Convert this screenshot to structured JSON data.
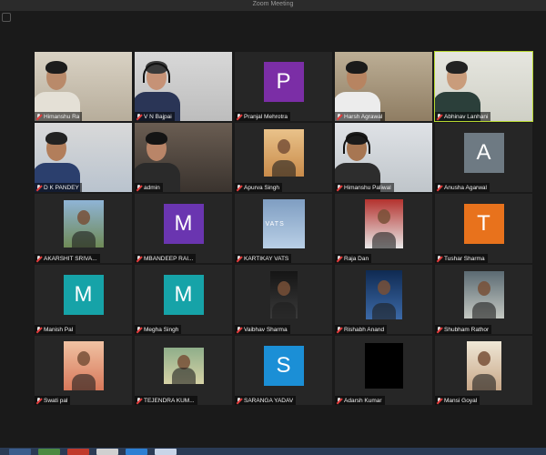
{
  "window": {
    "title": "Zoom Meeting"
  },
  "colors": {
    "tile_bg": "#262626",
    "active_border": "#b6d630",
    "muted_mic": "#e23b3b"
  },
  "participants": [
    {
      "name": "Himanshu Ra",
      "type": "video"
    },
    {
      "name": "V N Bajpai",
      "type": "video"
    },
    {
      "name": "Pranjal Mehrotra",
      "type": "initial",
      "initial": "P",
      "color": "#7b2ea6"
    },
    {
      "name": "Harsh Agrawal",
      "type": "video"
    },
    {
      "name": "Abhinav Lanhani",
      "type": "video",
      "active": true
    },
    {
      "name": "D K PANDEY",
      "type": "video"
    },
    {
      "name": "admin",
      "type": "video"
    },
    {
      "name": "Apurva Singh",
      "type": "photo"
    },
    {
      "name": "Himanshu Paliwal",
      "type": "video"
    },
    {
      "name": "Anusha Agarwal",
      "type": "initial",
      "initial": "A",
      "color": "#6e7a83"
    },
    {
      "name": "AKARSHIT SRIVA...",
      "type": "photo"
    },
    {
      "name": "MBANDEEP RAI...",
      "type": "initial",
      "initial": "M",
      "color": "#6a35b0"
    },
    {
      "name": "KARTIKAY VATS",
      "type": "photo",
      "photo_text": "VATS"
    },
    {
      "name": "Raja Dan",
      "type": "photo"
    },
    {
      "name": "Tushar Sharma",
      "type": "initial",
      "initial": "T",
      "color": "#e8721c"
    },
    {
      "name": "Manish Pal",
      "type": "initial",
      "initial": "M",
      "color": "#16a3a8"
    },
    {
      "name": "Megha Singh",
      "type": "initial",
      "initial": "M",
      "color": "#16a3a8"
    },
    {
      "name": "Vaibhav Sharma",
      "type": "photo"
    },
    {
      "name": "Rishabh Anand",
      "type": "photo"
    },
    {
      "name": "Shubham Rathor",
      "type": "photo"
    },
    {
      "name": "Swati pal",
      "type": "photo"
    },
    {
      "name": "TEJENDRA KUM...",
      "type": "photo"
    },
    {
      "name": "SARANGA YADAV",
      "type": "initial",
      "initial": "S",
      "color": "#1b8fd6"
    },
    {
      "name": "Adarsh Kumar",
      "type": "blank"
    },
    {
      "name": "Mansi Goyal",
      "type": "photo"
    }
  ]
}
